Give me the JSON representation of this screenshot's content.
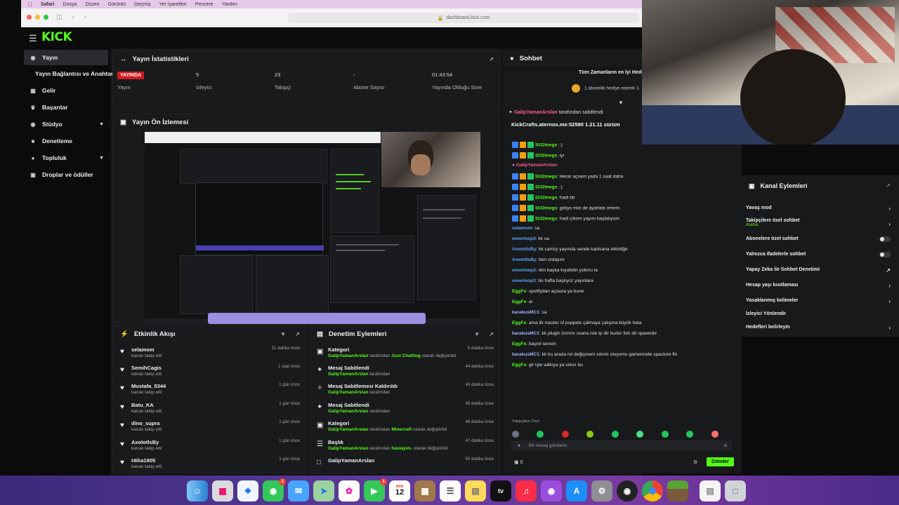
{
  "menubar": {
    "items": [
      "Safari",
      "Dosya",
      "Düzen",
      "Görüntü",
      "Geçmiş",
      "Yer İşaretleri",
      "Pencere",
      "Yardım"
    ]
  },
  "browser": {
    "url": "dashboard.kick.com"
  },
  "app": {
    "logo": "KICK"
  },
  "sidebar": {
    "items": [
      {
        "label": "Yayın",
        "icon": "broadcast-icon"
      },
      {
        "label": "Yayın Bağlantısı ve Anahtarı",
        "icon": ""
      },
      {
        "label": "Gelir",
        "icon": "dollar-icon"
      },
      {
        "label": "Başarılar",
        "icon": "trophy-icon"
      },
      {
        "label": "Stüdyo",
        "icon": "studio-icon"
      },
      {
        "label": "Denetleme",
        "icon": "shield-icon"
      },
      {
        "label": "Topluluk",
        "icon": "community-icon"
      },
      {
        "label": "Droplar ve ödüller",
        "icon": "gift-icon"
      }
    ]
  },
  "stats": {
    "title": "Yayın İstatistikleri",
    "live_badge": "YAYINDA",
    "items": [
      {
        "value": "",
        "label": "Yayın"
      },
      {
        "value": "5",
        "label": "İzleyici"
      },
      {
        "value": "23",
        "label": "Takipçi"
      },
      {
        "value": "-",
        "label": "Abone Sayısı"
      },
      {
        "value": "01:43:54",
        "label": "Yayında Olduğu Süre"
      }
    ]
  },
  "preview": {
    "title": "Yayın Ön İzlemesi"
  },
  "activity": {
    "title": "Etkinlik Akışı",
    "rows": [
      {
        "name": "selamom",
        "sub": "kanalı takip etti",
        "time": "31 dakika önce"
      },
      {
        "name": "SemihCagis",
        "sub": "kanalı takip etti",
        "time": "1 saat önce"
      },
      {
        "name": "Mustafa_5344",
        "sub": "kanalı takip etti",
        "time": "1 gün önce"
      },
      {
        "name": "Batu_KA",
        "sub": "kanalı takip etti",
        "time": "1 gün önce"
      },
      {
        "name": "dino_supra",
        "sub": "kanalı takip etti",
        "time": "1 gün önce"
      },
      {
        "name": "AxolotlsBy",
        "sub": "kanalı takip etti",
        "time": "1 gün önce"
      },
      {
        "name": "t4iha1905",
        "sub": "kanalı takip etti",
        "time": "1 gün önce"
      }
    ]
  },
  "mod_actions": {
    "title": "Denetim Eylemleri",
    "rows": [
      {
        "name": "Kategori",
        "actor": "GalipYamanArslan",
        "mid": " tarafından ",
        "value": "Just Chatting",
        "tail": " olarak değiştirildi",
        "time": "5 dakika önce"
      },
      {
        "name": "Mesaj Sabitlendi",
        "actor": "GalipYamanArslan",
        "mid": " tarafından",
        "value": "",
        "tail": "",
        "time": "44 dakika önce"
      },
      {
        "name": "Mesaj Sabitlemesi Kaldırıldı",
        "actor": "GalipYamanArslan",
        "mid": " tarafından",
        "value": "",
        "tail": "",
        "time": "45 dakika önce"
      },
      {
        "name": "Mesaj Sabitlendi",
        "actor": "GalipYamanArslan",
        "mid": " tarafından",
        "value": "",
        "tail": "",
        "time": "45 dakika önce"
      },
      {
        "name": "Kategori",
        "actor": "GalipYamanArslan",
        "mid": " tarafından ",
        "value": "Minecraft",
        "tail": " olarak değiştirildi",
        "time": "46 dakika önce"
      },
      {
        "name": "Başlık",
        "actor": "GalipYamanArslan",
        "mid": " tarafından ",
        "value": "haslayım.",
        "tail": " olarak değiştirildi",
        "time": "47 dakika önce"
      },
      {
        "name": "GalipYamanArslan",
        "actor": "",
        "mid": "",
        "value": "",
        "tail": "",
        "time": "50 dakika önce"
      }
    ]
  },
  "chat": {
    "title": "Sohbet",
    "top_gifter": "Tüm Zamanların en İyi Hediye",
    "gift_line": "1 abonelik hediye ederek 1.",
    "pinned_user": "GalipYamanArslan",
    "pinned_suffix": "tarafından sabitlendi",
    "pinned_text": "KickCrafts.aternos.me:52590 1.21.11 sürüm",
    "messages": [
      {
        "user": "St32megs",
        "text": ":)",
        "color": "#53fc18",
        "badges": true
      },
      {
        "user": "St32megs",
        "text": "iyi",
        "color": "#53fc18",
        "badges": true
      },
      {
        "user": "GalipYamanArslan",
        "text": "",
        "color": "#ff5f8d",
        "badges": false
      },
      {
        "user": "St32megs",
        "text": "tekrar açsam yada 1 saat daha",
        "color": "#53fc18",
        "badges": true
      },
      {
        "user": "St32megs",
        "text": ":)",
        "color": "#53fc18",
        "badges": true
      },
      {
        "user": "St32megs",
        "text": "hadi bb",
        "color": "#53fc18",
        "badges": true
      },
      {
        "user": "St32megs",
        "text": "geliyo mici de ayarladı mhem",
        "color": "#53fc18",
        "badges": true
      },
      {
        "user": "St32megs",
        "text": "hadi çıktım yayını başlatıyom",
        "color": "#53fc18",
        "badges": true
      },
      {
        "user": "selamom",
        "text": "sa",
        "color": "#60a5fa",
        "badges": false
      },
      {
        "user": "omerloop3",
        "text": "kk sa",
        "color": "#60a5fa",
        "badges": false
      },
      {
        "user": "AxolotlsBy",
        "text": "kk camzy yayında sende katılsana etkinliğe",
        "color": "#60a5fa",
        "badges": false
      },
      {
        "user": "AxolotlsBy",
        "text": "ben ordayım",
        "color": "#60a5fa",
        "badges": false
      },
      {
        "user": "omerloop3",
        "text": "olm başka kıyafetin yokmu la",
        "color": "#60a5fa",
        "badges": false
      },
      {
        "user": "omerloop3",
        "text": "bu hafta başlıyoz yayınlara",
        "color": "#60a5fa",
        "badges": false
      },
      {
        "user": "EggFe",
        "text": "spotifydan açsana ya bune",
        "color": "#53fc18",
        "badges": false
      },
      {
        "user": "EggFe",
        "text": "al",
        "color": "#53fc18",
        "badges": false
      },
      {
        "user": "karakusMC1",
        "text": "sa",
        "color": "#a5b4fc",
        "badges": false
      },
      {
        "user": "EggFe",
        "text": "ama ilk master of puppets çalmaya çalışma büyük hata",
        "color": "#53fc18",
        "badges": false
      },
      {
        "user": "karakusMC1",
        "text": "kk plugin lzımmı ssana iste tp dir budur fish dir spawndır",
        "color": "#a5b4fc",
        "badges": false
      },
      {
        "user": "EggFe",
        "text": "başrol sensin",
        "color": "#53fc18",
        "badges": false
      },
      {
        "user": "karakusMC1",
        "text": "kk bu arada rol değişmem sıkıntı oluyomu gamemode spactore fln",
        "color": "#a5b4fc",
        "badges": false
      },
      {
        "user": "EggFe",
        "text": "gir işte valloya ya sıkıcı bu",
        "color": "#53fc18",
        "badges": false
      }
    ],
    "follower_only": "Takipçilere Özel",
    "input_placeholder": "Bir mesaj gönderin",
    "points": "0",
    "send_label": "Gönder"
  },
  "channel_actions": {
    "title": "Kanal Eylemleri",
    "items": [
      {
        "label": "Yavaş mod",
        "sub": "",
        "control": "chevron"
      },
      {
        "label": "Takipçilere özel sohbet",
        "sub": "Arama",
        "control": "chevron"
      },
      {
        "label": "Abonelere özel sohbet",
        "sub": "",
        "control": "toggle"
      },
      {
        "label": "Yalnızca ifadelerle sohbet",
        "sub": "",
        "control": "toggle"
      },
      {
        "label": "Yapay Zeka ile Sohbet Denetimi",
        "sub": "",
        "control": "external"
      },
      {
        "label": "Hesap yaşı kısıtlaması",
        "sub": "",
        "control": "chevron"
      },
      {
        "label": "Yasaklanmış kelimeler",
        "sub": "",
        "control": "chevron"
      },
      {
        "label": "İzleyici Yönlendir",
        "sub": "",
        "control": "none"
      },
      {
        "label": "Hedefleri belirleyin",
        "sub": "",
        "control": "chevron"
      }
    ]
  },
  "dock": {
    "calendar_day": "12",
    "calendar_month": "ARA",
    "mail_badge": "2",
    "facetime_badge": "1",
    "apps": [
      "finder-icon",
      "launchpad-icon",
      "safari-icon",
      "messages-icon",
      "mail-icon",
      "maps-icon",
      "photos-icon",
      "facetime-icon",
      "calendar-icon",
      "notes-app-icon",
      "reminders-icon",
      "notes-icon",
      "tv-icon",
      "music-icon",
      "podcasts-icon",
      "appstore-icon",
      "settings-icon",
      "obs-icon",
      "chrome-icon",
      "minecraft-icon",
      "document-icon",
      "trash-icon"
    ]
  },
  "colors": {
    "accent": "#53fc18",
    "live": "#d0191c",
    "panel": "#191a1c"
  }
}
